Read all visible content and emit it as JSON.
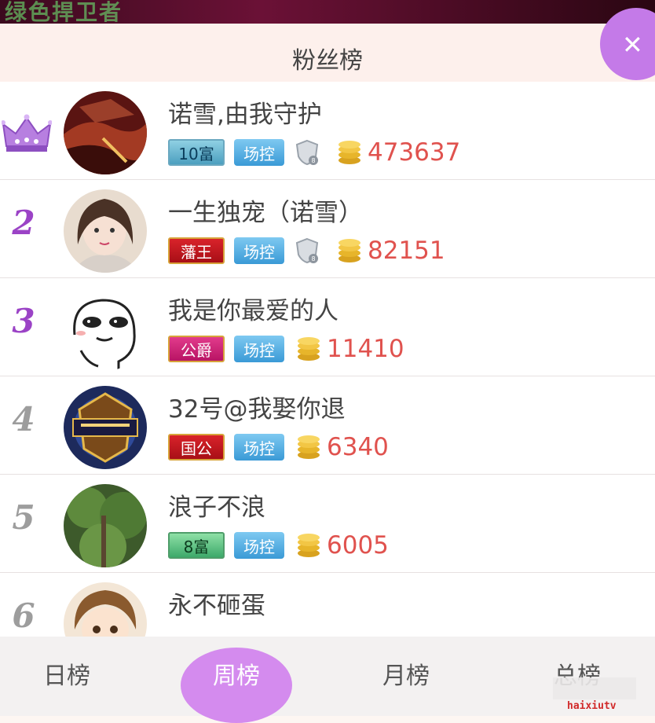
{
  "background_title": "绿色捍卫者",
  "header": {
    "title": "粉丝榜",
    "close_icon": "close-icon"
  },
  "rows": [
    {
      "rank": "1",
      "rank_icon": "crown-icon",
      "name": "诺雪,由我守护",
      "badge": "10富",
      "control": "场控",
      "shield_level": "8",
      "amount": "473637"
    },
    {
      "rank": "2",
      "name": "一生独宠（诺雪）",
      "badge": "藩王",
      "control": "场控",
      "shield_level": "8",
      "amount": "82151"
    },
    {
      "rank": "3",
      "name": "我是你最爱的人",
      "badge": "公爵",
      "control": "场控",
      "amount": "11410"
    },
    {
      "rank": "4",
      "name": "32号@我娶你退",
      "badge": "国公",
      "control": "场控",
      "amount": "6340"
    },
    {
      "rank": "5",
      "name": "浪子不浪",
      "badge": "8富",
      "control": "场控",
      "amount": "6005"
    },
    {
      "rank": "6",
      "name": "永不砸蛋"
    }
  ],
  "tabs": [
    {
      "label": "日榜",
      "active": false
    },
    {
      "label": "周榜",
      "active": true
    },
    {
      "label": "月榜",
      "active": false
    },
    {
      "label": "总榜",
      "active": false
    }
  ],
  "watermark": "haixiutv",
  "colors": {
    "accent": "#d48bee",
    "amount": "#e0524e",
    "rank_top": "#9b43c6"
  }
}
